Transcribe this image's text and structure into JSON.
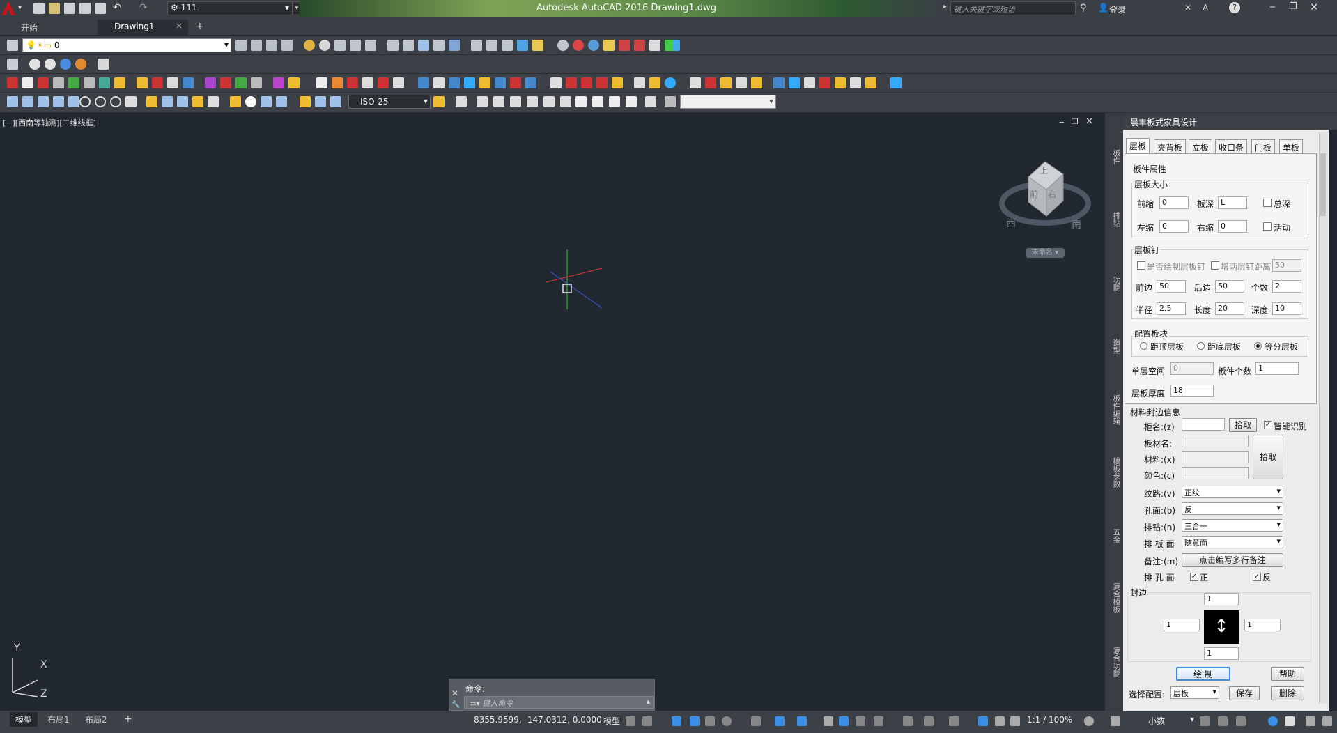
{
  "window": {
    "title": "Autodesk AutoCAD 2016    Drawing1.dwg",
    "workspace": "111",
    "search_placeholder": "键入关键字或短语",
    "login": "登录"
  },
  "tabs": {
    "start": "开始",
    "drawing": "Drawing1",
    "close_glyph": "×",
    "add_glyph": "+"
  },
  "layer": {
    "current": "0"
  },
  "dimstyle": {
    "current": "ISO-25"
  },
  "viewport": {
    "label": "[−][西南等轴测][二维线框]",
    "unnamed": "未命名",
    "compass_west": "西",
    "compass_south": "南",
    "cube_top": "上",
    "cube_left": "前",
    "cube_right": "右",
    "ucs_x": "X",
    "ucs_y": "Y",
    "ucs_z": "Z"
  },
  "command": {
    "prompt": "命令:",
    "placeholder": "键入命令"
  },
  "strip_tabs": [
    "板件",
    "排钻",
    "功能",
    "造型",
    "板件编辑",
    "模板参数",
    "五金",
    "复合模板",
    "复合功能"
  ],
  "panel": {
    "title": "晨丰板式家具设计",
    "tabs": [
      "层板",
      "夹背板",
      "立板",
      "收口条",
      "门板",
      "单板"
    ],
    "section_props": "板件属性",
    "section_size": "层板大小",
    "front_shrink_label": "前缩",
    "front_shrink": "0",
    "depth_label": "板深",
    "depth": "L",
    "total_depth": "总深",
    "left_shrink_label": "左缩",
    "left_shrink": "0",
    "right_shrink_label": "右缩",
    "right_shrink": "0",
    "movable": "活动",
    "section_pins": "层板钉",
    "draw_pins": "是否绘制层板钉",
    "add_pin_dist": "增两层钉距离",
    "pin_dist": "50",
    "front_edge_label": "前边",
    "front_edge": "50",
    "back_edge_label": "后边",
    "back_edge": "50",
    "count_label": "个数",
    "count": "2",
    "radius_label": "半径",
    "radius": "2.5",
    "length_label": "长度",
    "length": "20",
    "deep_label": "深度",
    "deep": "10",
    "section_config": "配置板块",
    "opt_top": "距顶层板",
    "opt_bottom": "距底层板",
    "opt_equal": "等分层板",
    "single_space_label": "单层空间",
    "single_space": "0",
    "board_count_label": "板件个数",
    "board_count": "1",
    "thickness_label": "层板厚度",
    "thickness": "18",
    "section_material": "材料封边信息",
    "cabinet_label": "柜名:(z)",
    "pick": "拾取",
    "smart": "智能识别",
    "board_name_label": "板材名:",
    "material_label": "材料:(x)",
    "color_label": "颜色:(c)",
    "pick2": "拾取",
    "grain_label": "纹路:(v)",
    "grain": "正纹",
    "hole_face_label": "孔面:(b)",
    "hole_face": "反",
    "drill_label": "排钻:(n)",
    "drill": "三合一",
    "drill_face_label": "排 板 面",
    "drill_face": "随意面",
    "note_label": "备注:(m)",
    "note_btn": "点击编写多行备注",
    "hole_side_label": "排 孔 面",
    "front": "正",
    "back": "反",
    "edge_label": "封边",
    "edge_top": "1",
    "edge_left": "1",
    "edge_right": "1",
    "edge_bottom": "1",
    "draw_btn": "绘  制",
    "help_btn": "帮助",
    "select_config_label": "选择配置:",
    "select_config": "层板",
    "save_btn": "保存",
    "delete_btn": "删除"
  },
  "status": {
    "model_tab": "模型",
    "layout1": "布局1",
    "layout2": "布局2",
    "add": "+",
    "coords": "8355.9599, -147.0312, 0.0000",
    "model": "模型",
    "scale": "1:1 / 100%",
    "units": "小数"
  }
}
